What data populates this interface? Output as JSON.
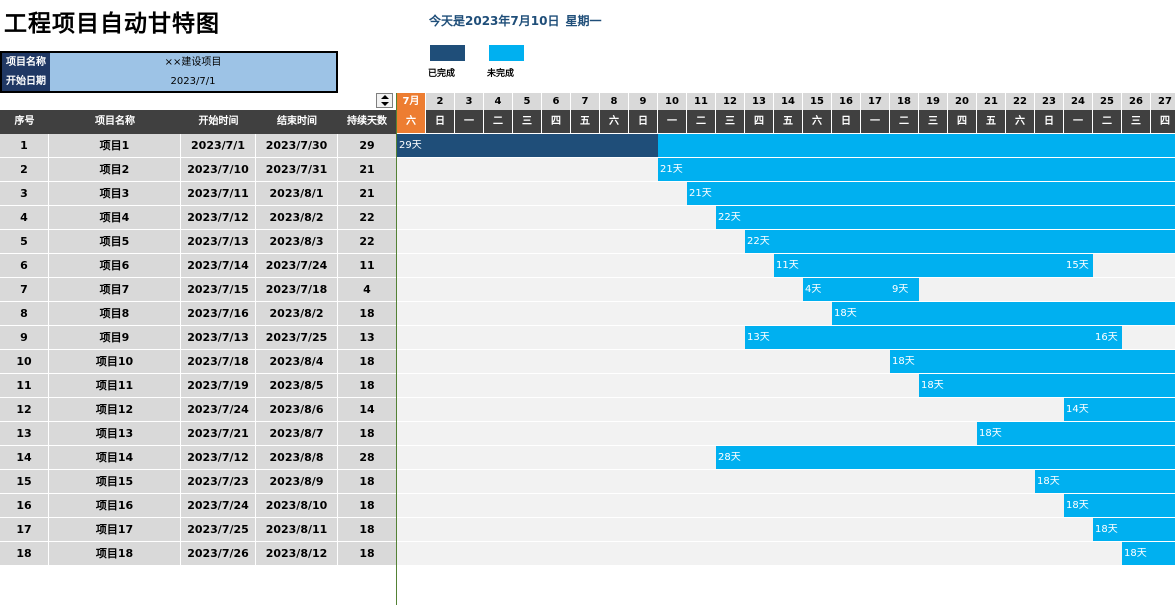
{
  "title": "工程项目自动甘特图",
  "today": {
    "prefix": "今天是2023年7月10日",
    "weekday": "星期一"
  },
  "legend": [
    {
      "label": "已完成",
      "color": "#1f4e79"
    },
    {
      "label": "未完成",
      "color": "#00b0f0"
    }
  ],
  "info": {
    "name_key": "项目名称",
    "name_value": "××建设项目",
    "start_key": "开始日期",
    "start_value": "2023/7/1"
  },
  "headers": [
    "序号",
    "项目名称",
    "开始时间",
    "结束时间",
    "持续天数"
  ],
  "calendar": {
    "first_label": "7月",
    "days": [
      2,
      3,
      4,
      5,
      6,
      7,
      8,
      9,
      10,
      11,
      12,
      13,
      14,
      15,
      16,
      17,
      18,
      19,
      20,
      21,
      22,
      23,
      24,
      25,
      26,
      27
    ],
    "weekdays": [
      "六",
      "日",
      "一",
      "二",
      "三",
      "四",
      "五",
      "六",
      "日",
      "一",
      "二",
      "三",
      "四",
      "五",
      "六",
      "日",
      "一",
      "二",
      "三",
      "四",
      "五",
      "六",
      "日",
      "一",
      "二",
      "三",
      "四"
    ]
  },
  "colors": {
    "completed": "#1f4e79",
    "incomplete": "#00b0f0",
    "current_day": "#ed7d31"
  },
  "rows": [
    {
      "no": "1",
      "name": "项目1",
      "start": "2023/7/1",
      "end": "2023/7/30",
      "duration": "29",
      "labels": [
        {
          "day": 1,
          "text": "29天"
        }
      ]
    },
    {
      "no": "2",
      "name": "项目2",
      "start": "2023/7/10",
      "end": "2023/7/31",
      "duration": "21",
      "labels": [
        {
          "day": 10,
          "text": "21天"
        }
      ]
    },
    {
      "no": "3",
      "name": "项目3",
      "start": "2023/7/11",
      "end": "2023/8/1",
      "duration": "21",
      "labels": [
        {
          "day": 11,
          "text": "21天"
        }
      ]
    },
    {
      "no": "4",
      "name": "项目4",
      "start": "2023/7/12",
      "end": "2023/8/2",
      "duration": "22",
      "labels": [
        {
          "day": 12,
          "text": "22天"
        }
      ]
    },
    {
      "no": "5",
      "name": "项目5",
      "start": "2023/7/13",
      "end": "2023/8/3",
      "duration": "22",
      "labels": [
        {
          "day": 13,
          "text": "22天"
        }
      ]
    },
    {
      "no": "6",
      "name": "项目6",
      "start": "2023/7/14",
      "end": "2023/7/24",
      "duration": "11",
      "labels": [
        {
          "day": 14,
          "text": "11天"
        },
        {
          "day": 24,
          "text": "15天"
        }
      ]
    },
    {
      "no": "7",
      "name": "项目7",
      "start": "2023/7/15",
      "end": "2023/7/18",
      "duration": "4",
      "labels": [
        {
          "day": 15,
          "text": "4天"
        },
        {
          "day": 18,
          "text": "9天"
        }
      ]
    },
    {
      "no": "8",
      "name": "项目8",
      "start": "2023/7/16",
      "end": "2023/8/2",
      "duration": "18",
      "labels": [
        {
          "day": 16,
          "text": "18天"
        }
      ]
    },
    {
      "no": "9",
      "name": "项目9",
      "start": "2023/7/13",
      "end": "2023/7/25",
      "duration": "13",
      "labels": [
        {
          "day": 13,
          "text": "13天"
        },
        {
          "day": 25,
          "text": "16天"
        }
      ]
    },
    {
      "no": "10",
      "name": "项目10",
      "start": "2023/7/18",
      "end": "2023/8/4",
      "duration": "18",
      "labels": [
        {
          "day": 18,
          "text": "18天"
        }
      ]
    },
    {
      "no": "11",
      "name": "项目11",
      "start": "2023/7/19",
      "end": "2023/8/5",
      "duration": "18",
      "labels": [
        {
          "day": 19,
          "text": "18天"
        }
      ]
    },
    {
      "no": "12",
      "name": "项目12",
      "start": "2023/7/24",
      "end": "2023/8/6",
      "duration": "14",
      "labels": [
        {
          "day": 24,
          "text": "14天"
        }
      ]
    },
    {
      "no": "13",
      "name": "项目13",
      "start": "2023/7/21",
      "end": "2023/8/7",
      "duration": "18",
      "labels": [
        {
          "day": 21,
          "text": "18天"
        }
      ]
    },
    {
      "no": "14",
      "name": "项目14",
      "start": "2023/7/12",
      "end": "2023/8/8",
      "duration": "28",
      "labels": [
        {
          "day": 12,
          "text": "28天"
        }
      ]
    },
    {
      "no": "15",
      "name": "项目15",
      "start": "2023/7/23",
      "end": "2023/8/9",
      "duration": "18",
      "labels": [
        {
          "day": 23,
          "text": "18天"
        }
      ]
    },
    {
      "no": "16",
      "name": "项目16",
      "start": "2023/7/24",
      "end": "2023/8/10",
      "duration": "18",
      "labels": [
        {
          "day": 24,
          "text": "18天"
        }
      ]
    },
    {
      "no": "17",
      "name": "项目17",
      "start": "2023/7/25",
      "end": "2023/8/11",
      "duration": "18",
      "labels": [
        {
          "day": 25,
          "text": "18天"
        }
      ]
    },
    {
      "no": "18",
      "name": "项目18",
      "start": "2023/7/26",
      "end": "2023/8/12",
      "duration": "18",
      "labels": [
        {
          "day": 26,
          "text": "18天"
        }
      ]
    }
  ]
}
